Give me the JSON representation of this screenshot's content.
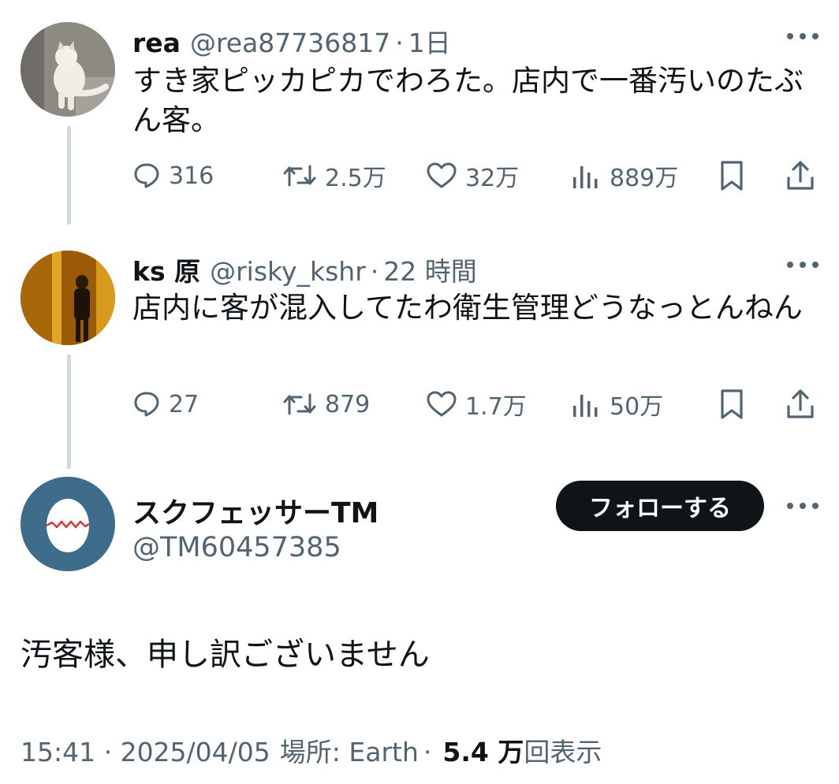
{
  "tweets": [
    {
      "display_name": "rea",
      "handle": "@rea87736817",
      "separator": "·",
      "time": "1日",
      "text": "すき家ピッカピカでわろた。店内で一番汚いのたぶん客。",
      "replies": "316",
      "retweets": "2.5万",
      "likes": "32万",
      "views": "889万",
      "avatar_icon": "cat-photo-avatar"
    },
    {
      "display_name": "ks 原",
      "handle": "@risky_kshr",
      "separator": "·",
      "time": "22 時間",
      "text": "店内に客が混入してたわ衛生管理どうなっとんねん",
      "replies": "27",
      "retweets": "879",
      "likes": "1.7万",
      "views": "50万",
      "avatar_icon": "doorway-photo-avatar"
    }
  ],
  "main_tweet": {
    "display_name": "スクフェッサーTM",
    "handle": "@TM60457385",
    "follow_label": "フォローする",
    "text": "汚客様、申し訳ございません",
    "timestamp": "15:41 · 2025/04/05",
    "location": "場所: Earth",
    "separator": "·",
    "views_count": "5.4 万",
    "views_label": "回表示",
    "avatar_icon": "egg-avatar"
  },
  "colors": {
    "text": "#0f1419",
    "secondary": "#536471",
    "thread_line": "#cfd9de",
    "button_bg": "#0f1419",
    "egg_avatar_bg": "#3d6d8a"
  }
}
